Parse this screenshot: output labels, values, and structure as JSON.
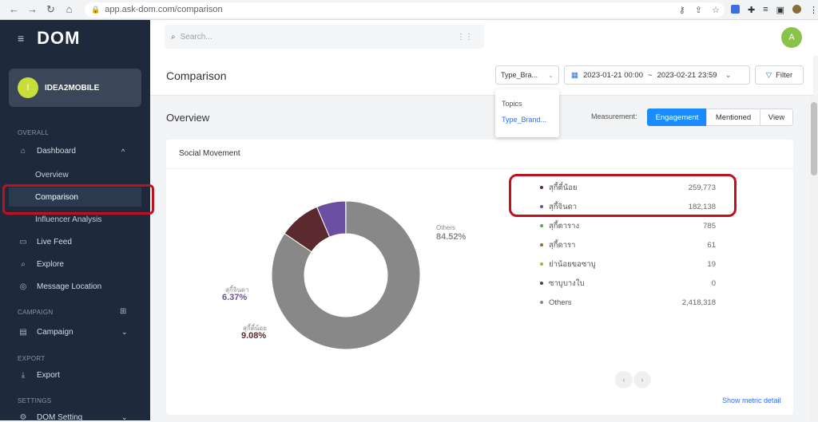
{
  "browser": {
    "url": "app.ask-dom.com/comparison"
  },
  "sidebar": {
    "logo": "DOM",
    "user": {
      "initial": "I",
      "name": "IDEA2MOBILE"
    },
    "sections": {
      "overall": "OVERALL",
      "campaign": "CAMPAIGN",
      "export": "EXPORT",
      "settings": "SETTINGS"
    },
    "items": {
      "dashboard": "Dashboard",
      "overview": "Overview",
      "comparison": "Comparison",
      "influencer": "Influencer Analysis",
      "livefeed": "Live Feed",
      "explore": "Explore",
      "message_location": "Message Location",
      "campaign": "Campaign",
      "export": "Export",
      "dom_setting": "DOM Setting"
    }
  },
  "topbar": {
    "search_placeholder": "Search...",
    "avatar_initial": "A"
  },
  "header": {
    "title": "Comparison",
    "type_select": "Type_Bra...",
    "date_start": "2023-01-21 00:00",
    "date_sep": "~",
    "date_end": "2023-02-21 23:59",
    "filter_label": "Filter"
  },
  "dropdown": {
    "options": [
      "Topics",
      "Type_Brand..."
    ]
  },
  "overview": {
    "title": "Overview",
    "measurement_label": "Measurement:",
    "tabs": [
      "Engagement",
      "Mentioned",
      "View"
    ],
    "active_tab": "Engagement"
  },
  "card": {
    "title": "Social Movement",
    "show_metric": "Show metric detail",
    "pie": {
      "others_label": "Others",
      "others_pct": "84.52%",
      "s2_label": "สุกี้จินดา",
      "s2_pct": "6.37%",
      "s1_label": "สุกี้ตี๋น้อย",
      "s1_pct": "9.08%"
    }
  },
  "chart_data": {
    "type": "pie",
    "title": "Social Movement",
    "categories": [
      "สุกี้ตี๋น้อย",
      "สุกี้จินดา",
      "สุกี้ตาราง",
      "สุกี้ดารา",
      "ย่าน้อยขอซาบู",
      "ซาบูบางใบ",
      "Others"
    ],
    "values": [
      259773,
      182138,
      785,
      61,
      19,
      0,
      2418318
    ],
    "value_labels": [
      "259,773",
      "182,138",
      "785",
      "61",
      "19",
      "0",
      "2,418,318"
    ],
    "colors": [
      "#5b2a2e",
      "#6b4fa0",
      "#4caf50",
      "#8a6d3b",
      "#b5a642",
      "#444444",
      "#888888"
    ],
    "legend": "right"
  },
  "colors": {
    "sidebar_bg": "#1e2a3b",
    "accent": "#1a8cff",
    "highlight": "#c0111f"
  }
}
